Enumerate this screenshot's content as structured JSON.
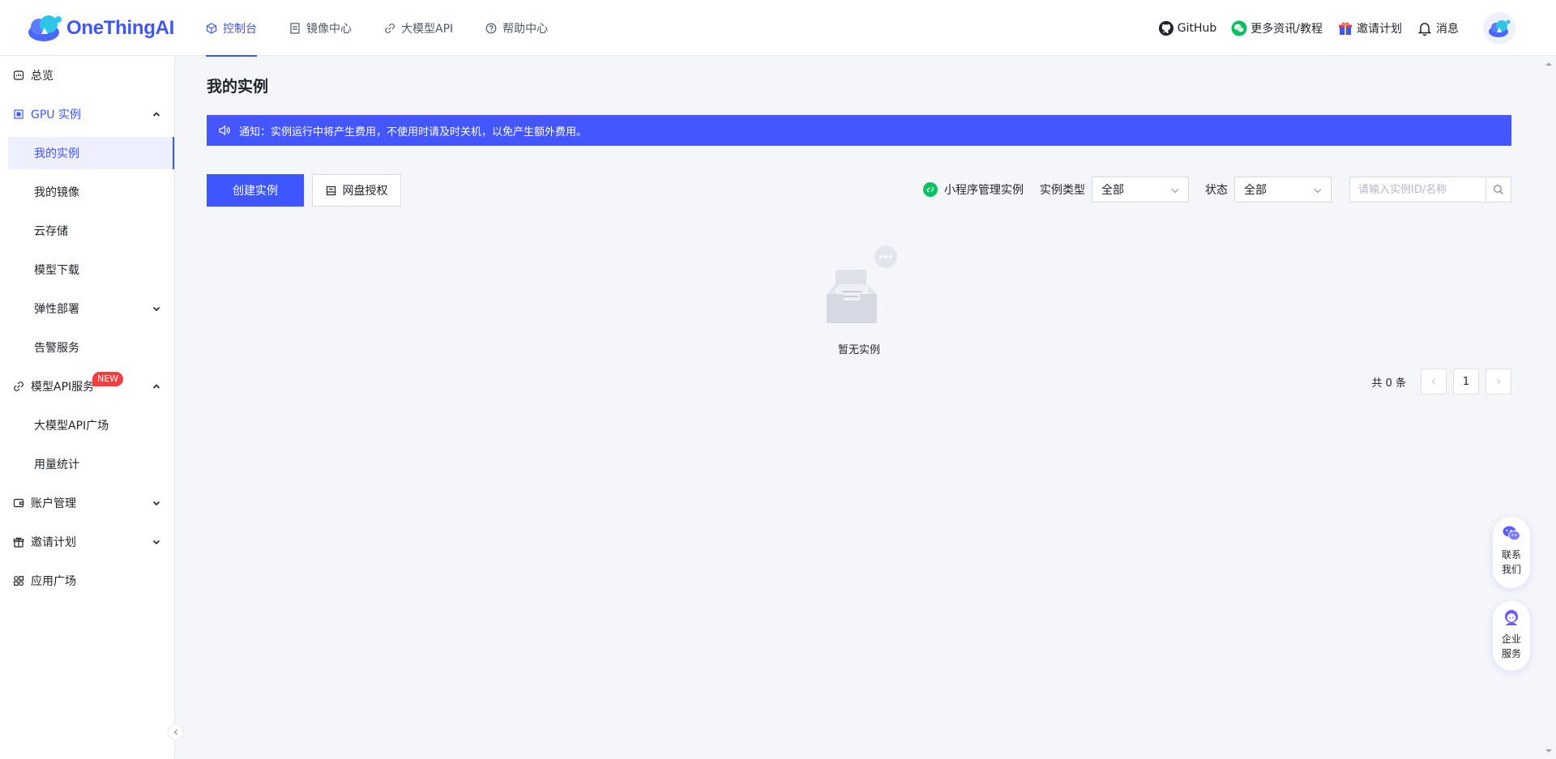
{
  "brand": {
    "name": "OneThingAI",
    "color": "#3d56ff"
  },
  "topnav": [
    {
      "label": "控制台",
      "icon": "cube-icon",
      "active": true
    },
    {
      "label": "镜像中心",
      "icon": "document-icon"
    },
    {
      "label": "大模型API",
      "icon": "link-icon"
    },
    {
      "label": "帮助中心",
      "icon": "help-circle-icon"
    }
  ],
  "topright": {
    "github": "GitHub",
    "news": "更多资讯/教程",
    "invite": "邀请计划",
    "messages": "消息"
  },
  "sidebar": {
    "overview": "总览",
    "gpu": "GPU 实例",
    "my_instances": "我的实例",
    "my_images": "我的镜像",
    "cloud_storage": "云存储",
    "model_download": "模型下载",
    "elastic_deploy": "弹性部署",
    "alert_service": "告警服务",
    "model_api": "模型API服务",
    "new_badge": "NEW",
    "api_square": "大模型API广场",
    "usage_stats": "用量统计",
    "account": "账户管理",
    "invite": "邀请计划",
    "app_square": "应用广场"
  },
  "main": {
    "title": "我的实例",
    "notice": "通知：实例运行中将产生费用，不使用时请及时关机，以免产生额外费用。",
    "create_button": "创建实例",
    "netdisk_button": "网盘授权",
    "miniprogram_link": "小程序管理实例",
    "type_label": "实例类型",
    "type_value": "全部",
    "status_label": "状态",
    "status_value": "全部",
    "search_placeholder": "请输入实例ID/名称",
    "empty_text": "暂无实例",
    "pagination": {
      "total": "共 0 条",
      "current": "1"
    }
  },
  "floating": {
    "contact": "联系我们",
    "contact_l1": "联系",
    "contact_l2": "我们",
    "enterprise_l1": "企业",
    "enterprise_l2": "服务"
  },
  "colors": {
    "primary": "#3d56ff",
    "notice_bg": "#4457ff",
    "badge": "#f53f3f",
    "wechat": "#07c160"
  }
}
